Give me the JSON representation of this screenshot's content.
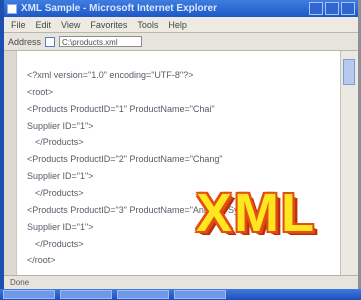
{
  "window": {
    "title": "XML Sample - Microsoft Internet Explorer"
  },
  "menu": {
    "items": [
      "File",
      "Edit",
      "View",
      "Favorites",
      "Tools",
      "Help"
    ]
  },
  "address": {
    "label": "Address",
    "value": "C:\\products.xml"
  },
  "code_lines": [
    "<?xml version=\"1.0\" encoding=\"UTF-8\"?>",
    "<root>",
    "<Products ProductID=\"1\" ProductName=\"Chai\"",
    "Supplier ID=\"1\">",
    "</Products>",
    "<Products ProductID=\"2\" ProductName=\"Chang\"",
    "Supplier ID=\"1\">",
    "</Products>",
    "<Products ProductID=\"3\" ProductName=\"Aniseed Syrup\"",
    "Supplier ID=\"1\">",
    "</Products>",
    "</root>"
  ],
  "badge": {
    "text": "XML"
  },
  "status": {
    "text": "Done"
  }
}
